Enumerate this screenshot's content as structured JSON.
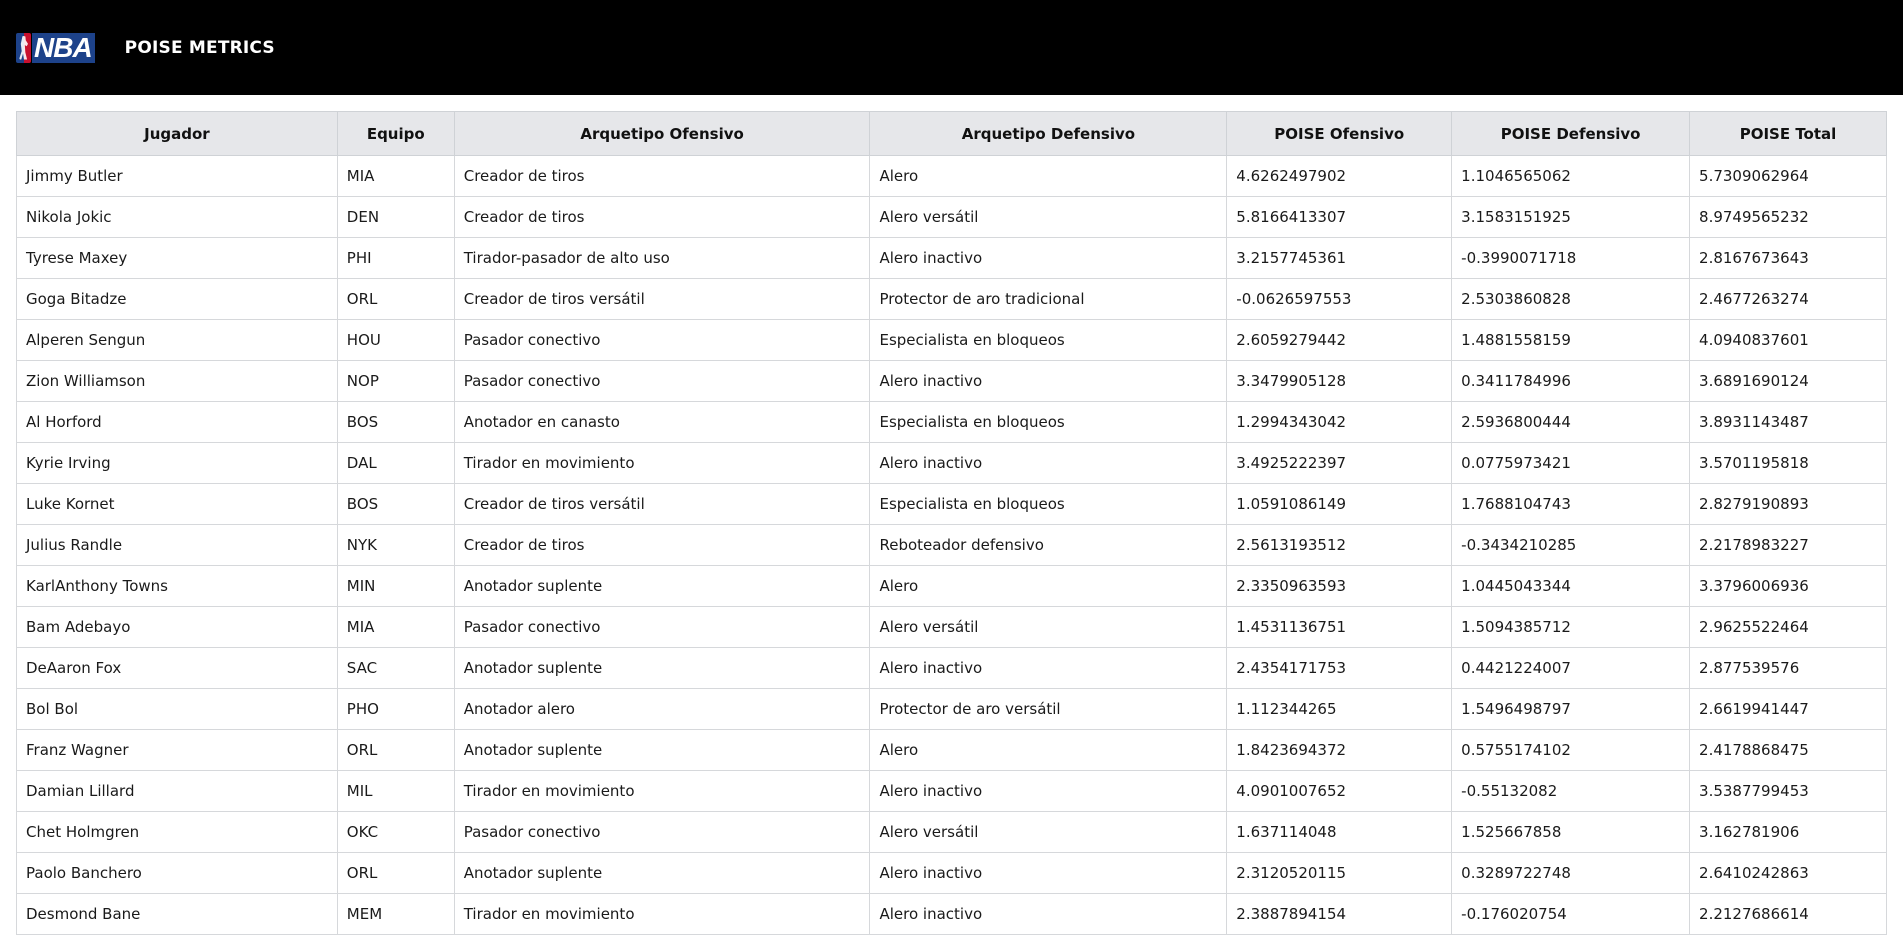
{
  "header": {
    "logo_text": "NBA",
    "brand": "POISE METRICS"
  },
  "table": {
    "columns": [
      "Jugador",
      "Equipo",
      "Arquetipo Ofensivo",
      "Arquetipo Defensivo",
      "POISE Ofensivo",
      "POISE Defensivo",
      "POISE Total"
    ],
    "rows": [
      [
        "Jimmy Butler",
        "MIA",
        "Creador de tiros",
        "Alero",
        "4.6262497902",
        "1.1046565062",
        "5.7309062964"
      ],
      [
        "Nikola Jokic",
        "DEN",
        "Creador de tiros",
        "Alero versátil",
        "5.8166413307",
        "3.1583151925",
        "8.9749565232"
      ],
      [
        "Tyrese Maxey",
        "PHI",
        "Tirador-pasador de alto uso",
        "Alero inactivo",
        "3.2157745361",
        "-0.3990071718",
        "2.8167673643"
      ],
      [
        "Goga Bitadze",
        "ORL",
        "Creador de tiros versátil",
        "Protector de aro tradicional",
        "-0.0626597553",
        "2.5303860828",
        "2.4677263274"
      ],
      [
        "Alperen Sengun",
        "HOU",
        "Pasador conectivo",
        "Especialista en bloqueos",
        "2.6059279442",
        "1.4881558159",
        "4.0940837601"
      ],
      [
        "Zion Williamson",
        "NOP",
        "Pasador conectivo",
        "Alero inactivo",
        "3.3479905128",
        "0.3411784996",
        "3.6891690124"
      ],
      [
        "Al Horford",
        "BOS",
        "Anotador en canasto",
        "Especialista en bloqueos",
        "1.2994343042",
        "2.5936800444",
        "3.8931143487"
      ],
      [
        "Kyrie Irving",
        "DAL",
        "Tirador en movimiento",
        "Alero inactivo",
        "3.4925222397",
        "0.0775973421",
        "3.5701195818"
      ],
      [
        "Luke Kornet",
        "BOS",
        "Creador de tiros versátil",
        "Especialista en bloqueos",
        "1.0591086149",
        "1.7688104743",
        "2.8279190893"
      ],
      [
        "Julius Randle",
        "NYK",
        "Creador de tiros",
        "Reboteador defensivo",
        "2.5613193512",
        "-0.3434210285",
        "2.2178983227"
      ],
      [
        "KarlAnthony Towns",
        "MIN",
        "Anotador suplente",
        "Alero",
        "2.3350963593",
        "1.0445043344",
        "3.3796006936"
      ],
      [
        "Bam Adebayo",
        "MIA",
        "Pasador conectivo",
        "Alero versátil",
        "1.4531136751",
        "1.5094385712",
        "2.9625522464"
      ],
      [
        "DeAaron Fox",
        "SAC",
        "Anotador suplente",
        "Alero inactivo",
        "2.4354171753",
        "0.4421224007",
        "2.877539576"
      ],
      [
        "Bol Bol",
        "PHO",
        "Anotador alero",
        "Protector de aro versátil",
        "1.112344265",
        "1.5496498797",
        "2.6619941447"
      ],
      [
        "Franz Wagner",
        "ORL",
        "Anotador suplente",
        "Alero",
        "1.8423694372",
        "0.5755174102",
        "2.4178868475"
      ],
      [
        "Damian Lillard",
        "MIL",
        "Tirador en movimiento",
        "Alero inactivo",
        "4.0901007652",
        "-0.55132082",
        "3.5387799453"
      ],
      [
        "Chet Holmgren",
        "OKC",
        "Pasador conectivo",
        "Alero versátil",
        "1.637114048",
        "1.525667858",
        "3.162781906"
      ],
      [
        "Paolo Banchero",
        "ORL",
        "Anotador suplente",
        "Alero inactivo",
        "2.3120520115",
        "0.3289722748",
        "2.6410242863"
      ],
      [
        "Desmond Bane",
        "MEM",
        "Tirador en movimiento",
        "Alero inactivo",
        "2.3887894154",
        "-0.176020754",
        "2.2127686614"
      ]
    ]
  },
  "colors": {
    "topbar": "#000000",
    "header_bg": "#e6e7ea",
    "nba_blue": "#1d428a",
    "nba_red": "#c8102e"
  }
}
